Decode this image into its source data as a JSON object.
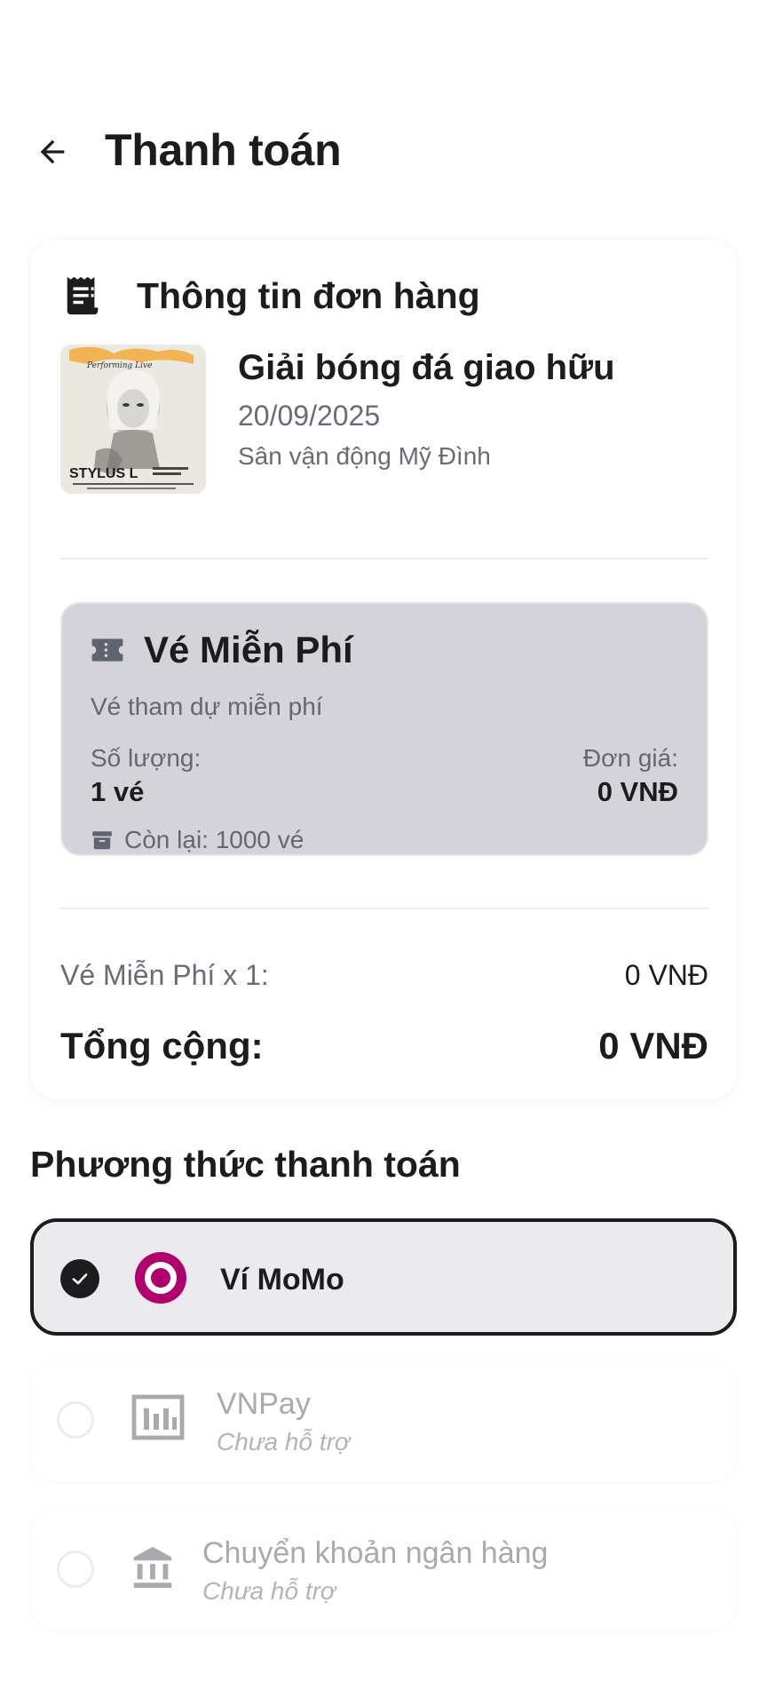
{
  "header": {
    "title": "Thanh toán",
    "back_icon": "arrow-left-icon"
  },
  "order": {
    "section_title": "Thông tin đơn hàng",
    "event": {
      "name": "Giải bóng đá giao hữu",
      "date": "20/09/2025",
      "venue": "Sân vận động Mỹ Đình",
      "poster_text": "STYLUS L"
    },
    "ticket": {
      "name": "Vé Miễn Phí",
      "description": "Vé tham dự miễn phí",
      "quantity_label": "Số lượng:",
      "quantity_value": "1 vé",
      "price_label": "Đơn giá:",
      "price_value": "0 VNĐ",
      "remaining": "Còn lại: 1000 vé"
    },
    "line_item": {
      "label": "Vé Miễn Phí x 1:",
      "value": "0 VNĐ"
    },
    "total": {
      "label": "Tổng cộng:",
      "value": "0 VNĐ"
    }
  },
  "payment": {
    "title": "Phương thức thanh toán",
    "options": [
      {
        "name": "Ví MoMo",
        "selected": true,
        "icon": "momo-icon"
      },
      {
        "name": "VNPay",
        "subtitle": "Chưa hỗ trợ",
        "selected": false,
        "icon": "vnpay-icon"
      },
      {
        "name": "Chuyển khoản ngân hàng",
        "subtitle": "Chưa hỗ trợ",
        "selected": false,
        "icon": "bank-icon"
      }
    ]
  },
  "colors": {
    "text_primary": "#1c1c1e",
    "text_secondary": "#6b6b73",
    "ticket_bg": "#d3d3d9",
    "selected_bg": "#ebebee",
    "momo_brand": "#b0006d",
    "disabled_text": "#a9a9ae"
  }
}
